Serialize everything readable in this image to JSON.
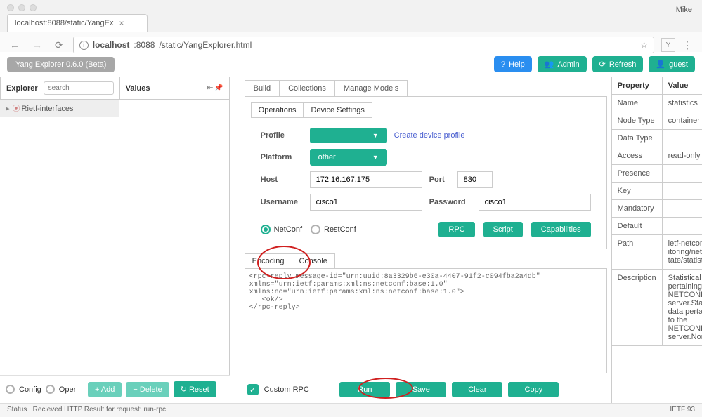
{
  "browser": {
    "profile": "Mike",
    "tab_title": "localhost:8088/static/YangEx",
    "url_host": "localhost",
    "url_port": ":8088",
    "url_path": "/static/YangExplorer.html"
  },
  "app": {
    "title": "Yang Explorer 0.6.0 (Beta)",
    "buttons": {
      "help": "Help",
      "admin": "Admin",
      "refresh": "Refresh",
      "guest": "guest"
    }
  },
  "explorer": {
    "title": "Explorer",
    "search_placeholder": "search",
    "values_title": "Values",
    "tree_item": "Rietf-interfaces",
    "config_label": "Config",
    "oper_label": "Oper",
    "add_btn": "+ Add",
    "delete_btn": "− Delete",
    "reset_btn": "↻ Reset"
  },
  "tabs": {
    "build": "Build",
    "collections": "Collections",
    "manage": "Manage Models",
    "operations": "Operations",
    "device_settings": "Device Settings"
  },
  "form": {
    "profile_label": "Profile",
    "profile_value": "",
    "create_link": "Create device profile",
    "platform_label": "Platform",
    "platform_value": "other",
    "host_label": "Host",
    "host_value": "172.16.167.175",
    "port_label": "Port",
    "port_value": "830",
    "username_label": "Username",
    "username_value": "cisco1",
    "password_label": "Password",
    "password_value": "cisco1"
  },
  "proto": {
    "netconf": "NetConf",
    "restconf": "RestConf",
    "rpc": "RPC",
    "script": "Script",
    "caps": "Capabilities"
  },
  "enc_tabs": {
    "encoding": "Encoding",
    "console": "Console"
  },
  "console_text": "<rpc-reply message-id=\"urn:uuid:8a3329b6-e30a-4407-91f2-c094fba2a4db\"\nxmlns=\"urn:ietf:params:xml:ns:netconf:base:1.0\"\nxmlns:nc=\"urn:ietf:params:xml:ns:netconf:base:1.0\">\n   <ok/>\n</rpc-reply>",
  "bottom": {
    "custom_rpc": "Custom RPC",
    "run": "Run",
    "save": "Save",
    "clear": "Clear",
    "copy": "Copy"
  },
  "props": {
    "header_prop": "Property",
    "header_val": "Value",
    "rows": [
      {
        "k": "Name",
        "v": "statistics"
      },
      {
        "k": "Node Type",
        "v": "container"
      },
      {
        "k": "Data Type",
        "v": ""
      },
      {
        "k": "Access",
        "v": "read-only"
      },
      {
        "k": "Presence",
        "v": ""
      },
      {
        "k": "Key",
        "v": ""
      },
      {
        "k": "Mandatory",
        "v": ""
      },
      {
        "k": "Default",
        "v": ""
      },
      {
        "k": "Path",
        "v": "ietf-netconf-monitoring/netconf-state/statistics"
      },
      {
        "k": "Description",
        "v": "Statistical data pertaining to the NETCONF server.Statistical data pertaining to the NETCONF server.None"
      }
    ]
  },
  "status": {
    "left": "Status : Recieved HTTP Result for request: run-rpc",
    "right": "IETF 93"
  }
}
